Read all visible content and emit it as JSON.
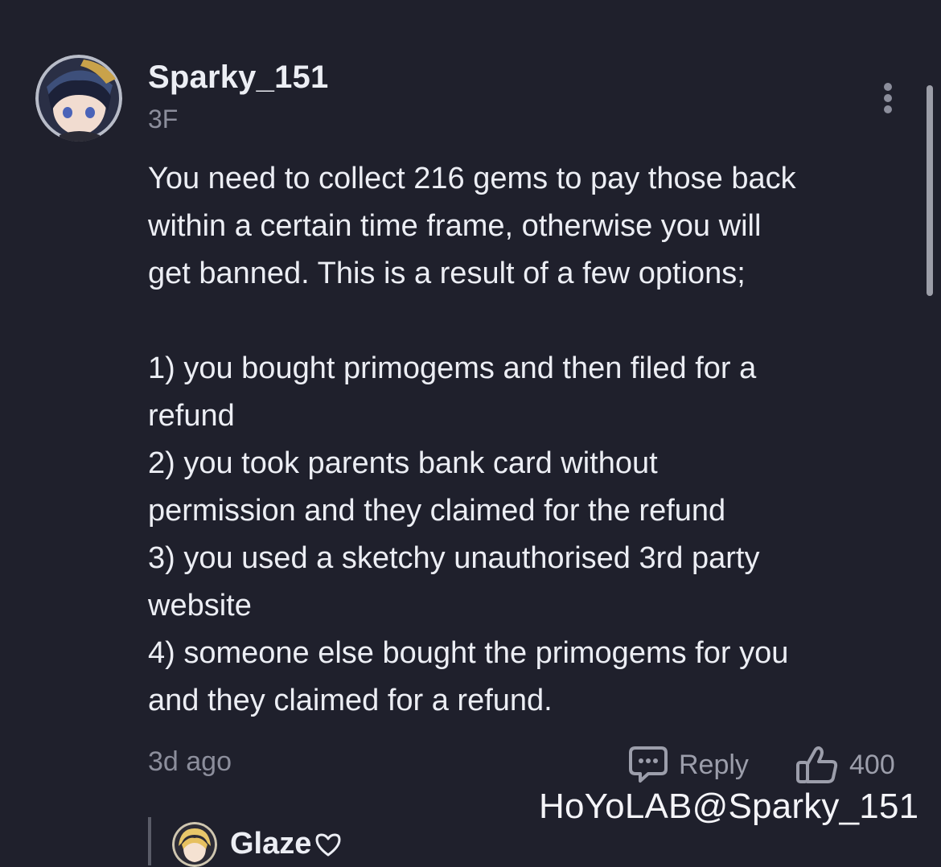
{
  "comment": {
    "username": "Sparky_151",
    "floor": "3F",
    "body_lines": [
      "You need to collect 216 gems to pay those back",
      "within a certain time frame, otherwise you will",
      "get banned. This is a result of a few options;"
    ],
    "options": [
      "1) you bought primogems and then filed for a",
      "refund",
      "2) you took parents bank card without",
      "permission and they claimed for the refund",
      "3) you used a sketchy unauthorised 3rd party",
      "website",
      "4) someone else bought the primogems for you",
      "and they claimed for a refund."
    ],
    "time": "3d ago",
    "reply_label": "Reply",
    "like_count": "400",
    "watermark": "HoYoLAB@Sparky_151"
  },
  "sub_reply": {
    "username": "Glaze"
  },
  "icons": {
    "more": "more-vertical-icon",
    "reply": "chat-bubble-icon",
    "like": "thumbs-up-icon",
    "heart": "heart-icon"
  },
  "colors": {
    "background": "#1f202c",
    "text": "#eceef4",
    "muted": "#8c8e9c"
  }
}
